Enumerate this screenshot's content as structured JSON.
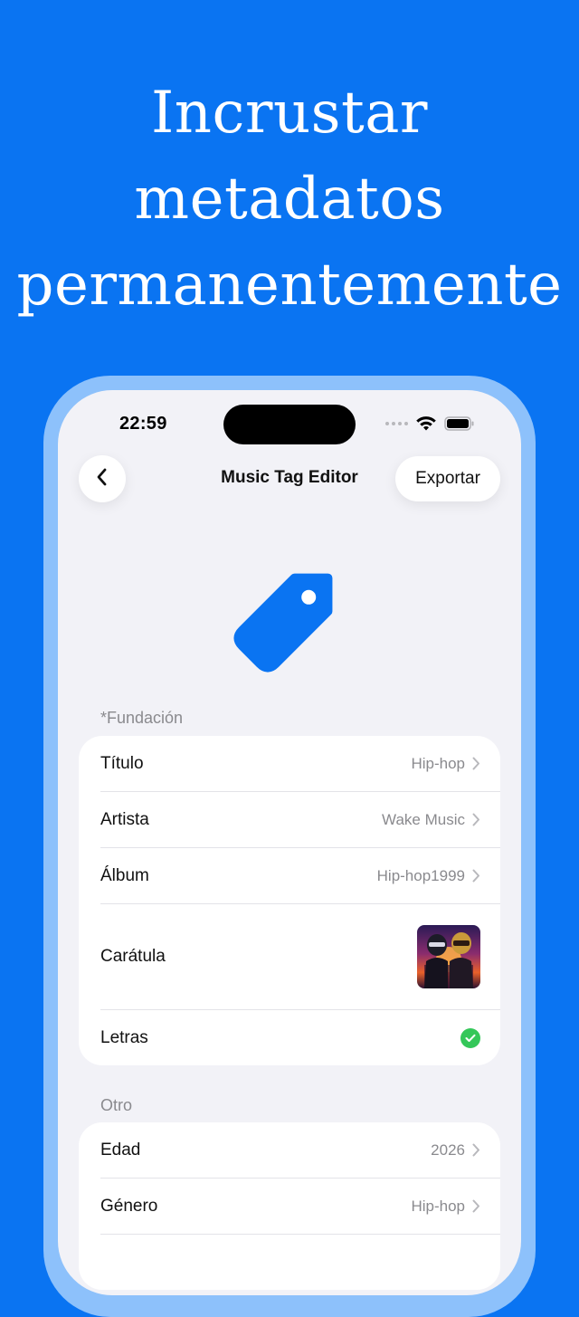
{
  "headline": {
    "line1": "Incrustar",
    "line2": "metadatos",
    "line3": "permanentemente"
  },
  "status_bar": {
    "time": "22:59"
  },
  "nav": {
    "title": "Music Tag Editor",
    "export_label": "Exportar"
  },
  "sections": {
    "foundation": {
      "label": "*Fundación",
      "rows": [
        {
          "label": "Título",
          "value": "Hip-hop"
        },
        {
          "label": "Artista",
          "value": "Wake Music"
        },
        {
          "label": "Álbum",
          "value": "Hip-hop1999"
        },
        {
          "label": "Carátula"
        },
        {
          "label": "Letras"
        }
      ]
    },
    "other": {
      "label": "Otro",
      "rows": [
        {
          "label": "Edad",
          "value": "2026"
        },
        {
          "label": "Género",
          "value": "Hip-hop"
        }
      ]
    }
  },
  "colors": {
    "background": "#0A74F2",
    "accent": "#0A74F2",
    "check": "#34C759",
    "frame": "#8DC1FB"
  },
  "icons": [
    "back-icon",
    "tag-icon",
    "chevron-right-icon",
    "check-icon",
    "wifi-icon",
    "battery-icon"
  ]
}
